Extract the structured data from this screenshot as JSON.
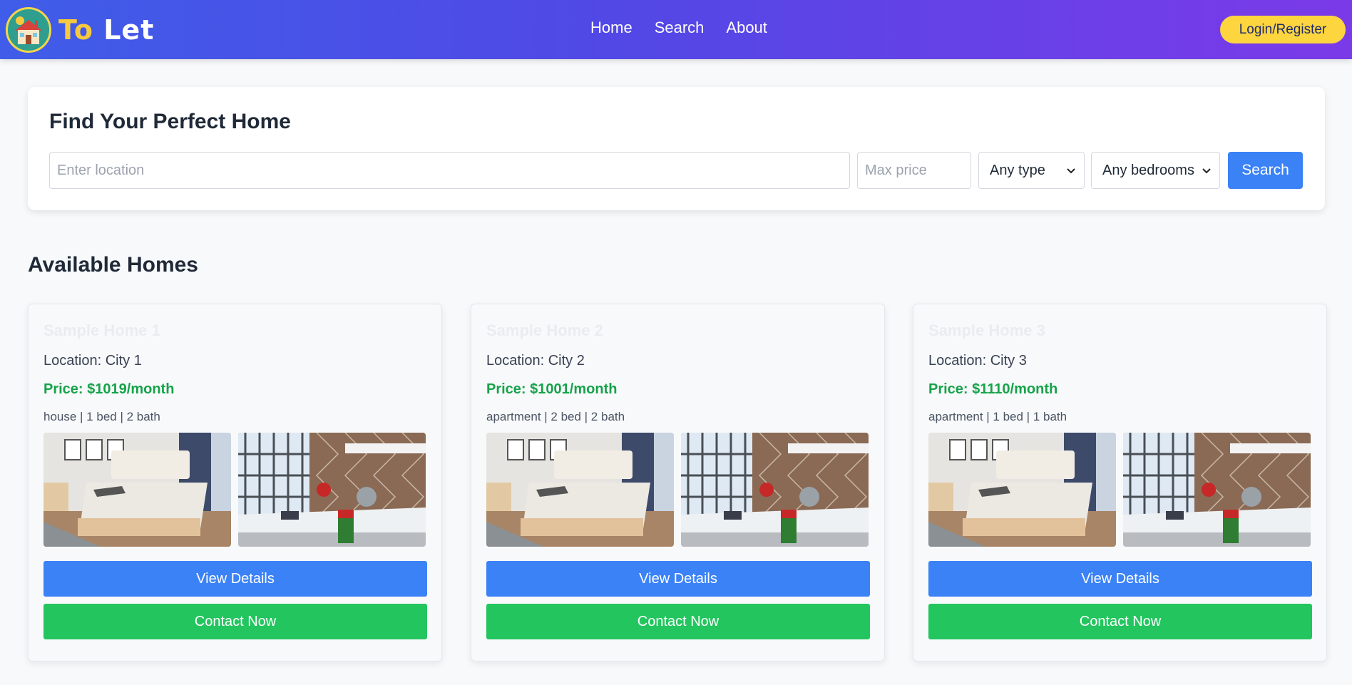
{
  "navbar": {
    "logo_icon": "house-logo-icon",
    "brand_part1": "To",
    "brand_part2": "Let",
    "links": [
      "Home",
      "Search",
      "About"
    ],
    "login_label": "Login/Register",
    "gradient_start": "#3f5de8",
    "gradient_end": "#7b3ae8",
    "login_color": "#fcd53f"
  },
  "search": {
    "title": "Find Your Perfect Home",
    "location_placeholder": "Enter location",
    "location_value": "",
    "price_placeholder": "Max price",
    "price_value": "",
    "type_selected": "Any type",
    "bedrooms_selected": "Any bedrooms",
    "button_label": "Search",
    "button_color": "#3b82f6"
  },
  "listings": {
    "title": "Available Homes",
    "homes": [
      {
        "name": "Sample Home 1",
        "location": "Location: City 1",
        "price": "Price: $1019/month",
        "specs": "house | 1 bed | 2 bath",
        "view_label": "View Details",
        "contact_label": "Contact Now"
      },
      {
        "name": "Sample Home 2",
        "location": "Location: City 2",
        "price": "Price: $1001/month",
        "specs": "apartment | 2 bed | 2 bath",
        "view_label": "View Details",
        "contact_label": "Contact Now"
      },
      {
        "name": "Sample Home 3",
        "location": "Location: City 3",
        "price": "Price: $1110/month",
        "specs": "apartment | 1 bed | 1 bath",
        "view_label": "View Details",
        "contact_label": "Contact Now"
      }
    ],
    "price_color": "#16a34a",
    "view_color": "#3b82f6",
    "contact_color": "#22c55e"
  }
}
